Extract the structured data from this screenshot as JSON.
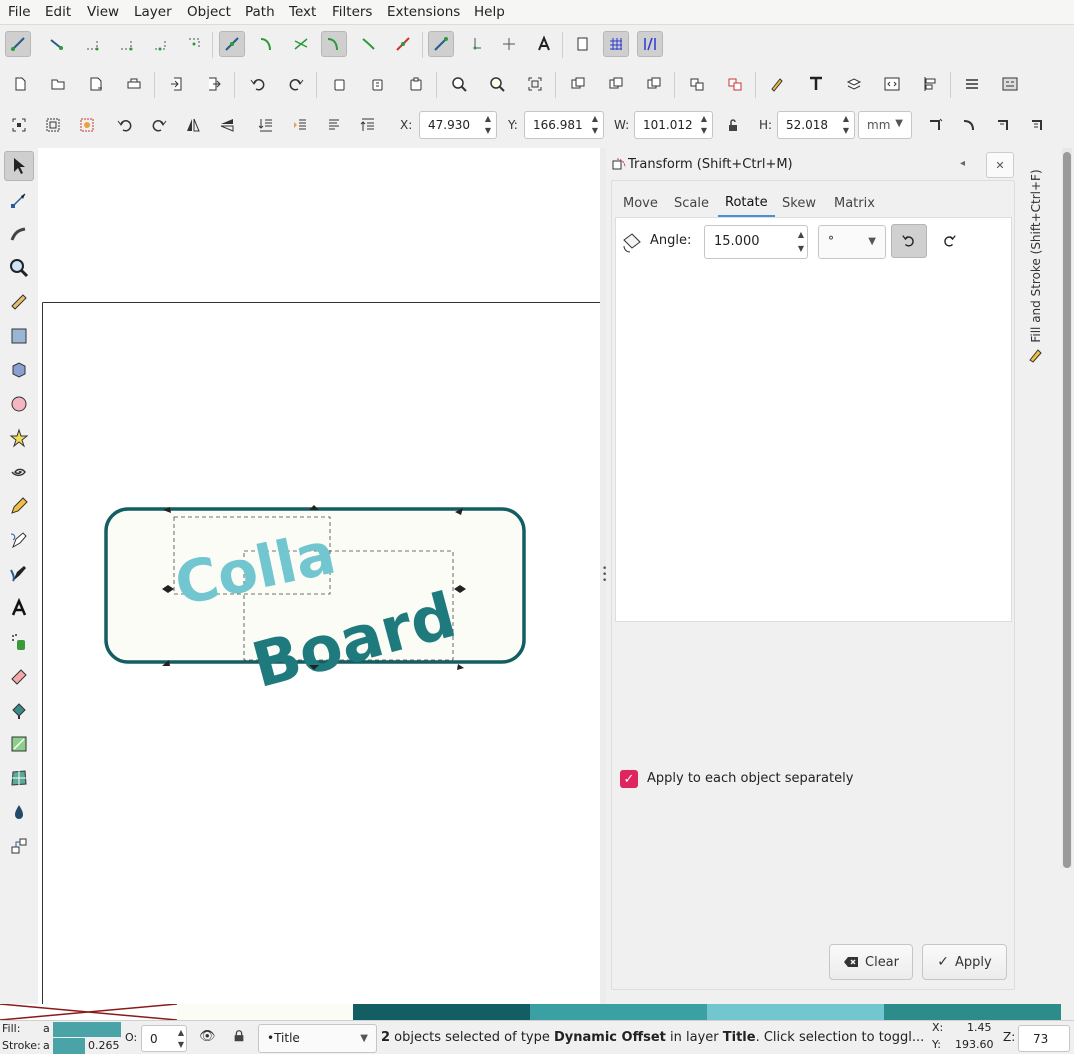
{
  "menubar": {
    "items": [
      "File",
      "Edit",
      "View",
      "Layer",
      "Object",
      "Path",
      "Text",
      "Filters",
      "Extensions",
      "Help"
    ]
  },
  "toolbar_select": {
    "x_label": "X:",
    "x_value": "47.930",
    "y_label": "Y:",
    "y_value": "166.981",
    "w_label": "W:",
    "w_value": "101.012",
    "h_label": "H:",
    "h_value": "52.018",
    "unit": "mm"
  },
  "canvas": {
    "text_colla": "Colla",
    "text_board": "Board",
    "colors": {
      "border": "#135e63",
      "board_text": "#1e7a7c",
      "colla_text": "#72c6d0",
      "background": "#fcfcf6"
    }
  },
  "transform_panel": {
    "title": "Transform (Shift+Ctrl+M)",
    "tabs": [
      "Move",
      "Scale",
      "Rotate",
      "Skew",
      "Matrix"
    ],
    "active_tab": "Rotate",
    "angle_label": "Angle:",
    "angle_value": "15.000",
    "angle_unit": "°",
    "apply_each_label": "Apply to each object separately",
    "apply_each_checked": true,
    "clear_label": "Clear",
    "apply_label": "Apply",
    "checkbox_color": "#e0245e"
  },
  "right_dock": {
    "fill_stroke_label": "Fill and Stroke (Shift+Ctrl+F)"
  },
  "palette": {
    "swatches": [
      "none",
      "#fcfcf6",
      "#135e63",
      "#3aa0a4",
      "#72c6d0",
      "#2c8c8a"
    ]
  },
  "statusbar": {
    "fill_label": "Fill:",
    "fill_value": "a",
    "stroke_label": "Stroke:",
    "stroke_value": "a",
    "stroke_width": "0.265",
    "opacity_label": "O:",
    "opacity_value": "0",
    "layer_value": "•Title",
    "message_count": "2",
    "message_part1": " objects selected of type ",
    "message_type": "Dynamic Offset",
    "message_part2": " in layer ",
    "message_layer": "Title",
    "message_part3": ". Click selection to toggl...",
    "cursor_x_label": "X:",
    "cursor_x": "1.45",
    "cursor_y_label": "Y:",
    "cursor_y": "193.60",
    "zoom_label": "Z:",
    "zoom_value": "73",
    "fill_color": "#4aa3a6"
  }
}
